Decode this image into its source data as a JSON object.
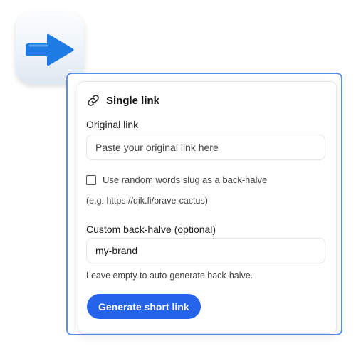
{
  "app_icon": {
    "name": "right-arrow-icon",
    "color": "#1e7be4"
  },
  "card": {
    "title": "Single link",
    "title_icon": "link-icon",
    "original_link": {
      "label": "Original link",
      "placeholder": "Paste your original link here",
      "value": ""
    },
    "random_slug": {
      "label": "Use random words slug as a back-halve",
      "checked": false,
      "example": "(e.g. https://qik.fi/brave-cactus)"
    },
    "custom_back_halve": {
      "label": "Custom back-halve (optional)",
      "value": "my-brand",
      "hint": "Leave empty to auto-generate back-halve."
    },
    "submit_label": "Generate short link"
  },
  "colors": {
    "accent": "#2563eb",
    "panel_border": "#5c8ee6"
  }
}
